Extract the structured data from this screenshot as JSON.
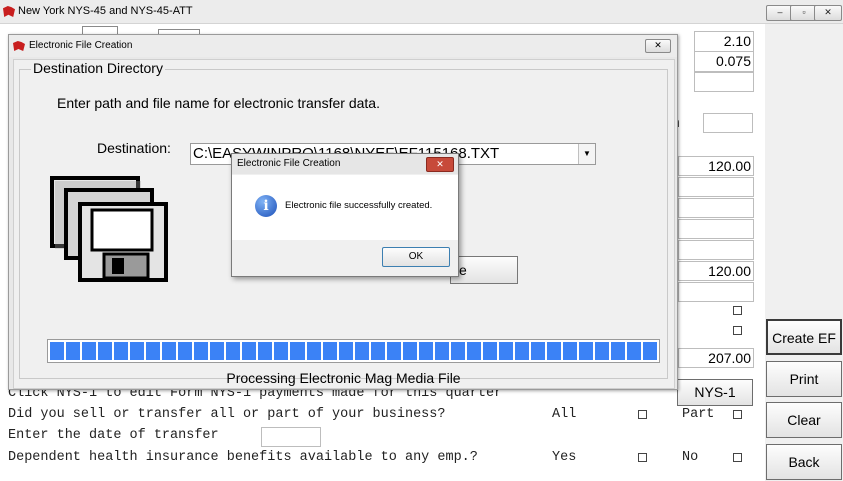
{
  "window": {
    "title": "New York NYS-45 and NYS-45-ATT",
    "buttons": [
      "–",
      "▫",
      "✕"
    ]
  },
  "fields": {
    "rate_1": "2.10",
    "rate_2": "0.075",
    "value_120a": "120.00",
    "value_120b": "120.00",
    "value_207": "207.00",
    "partial_label": "n"
  },
  "questions": {
    "nys1_text": "Click NYS-1 to edit Form NYS-1 payments made for this quarter",
    "sell_text": "Did you sell or transfer all or part of your business?",
    "all_label": "All",
    "part_label": "Part",
    "date_text": "Enter the date of transfer",
    "health_text": "Dependent health insurance benefits available to any emp.?",
    "yes_label": "Yes",
    "no_label": "No"
  },
  "side_buttons": {
    "create_ef": "Create EF",
    "print": "Print",
    "clear": "Clear",
    "back": "Back",
    "nys1": "NYS-1"
  },
  "dialog": {
    "title": "Electronic File Creation",
    "close": "✕",
    "group_title": "Destination Directory",
    "prompt": "Enter path and file name for electronic transfer data.",
    "destination_label": "Destination:",
    "destination_value": "C:\\EASYWINPRO\\1168\\NYEF\\EF115168.TXT",
    "hidden_button_fragment": "e",
    "progress_label": "Processing Electronic Mag Media File",
    "progress_percent": 100
  },
  "message_box": {
    "title": "Electronic File Creation",
    "close": "✕",
    "message": "Electronic file successfully created.",
    "ok": "OK"
  },
  "colors": {
    "progress": "#3b82f6",
    "close_red": "#c74a3a"
  }
}
